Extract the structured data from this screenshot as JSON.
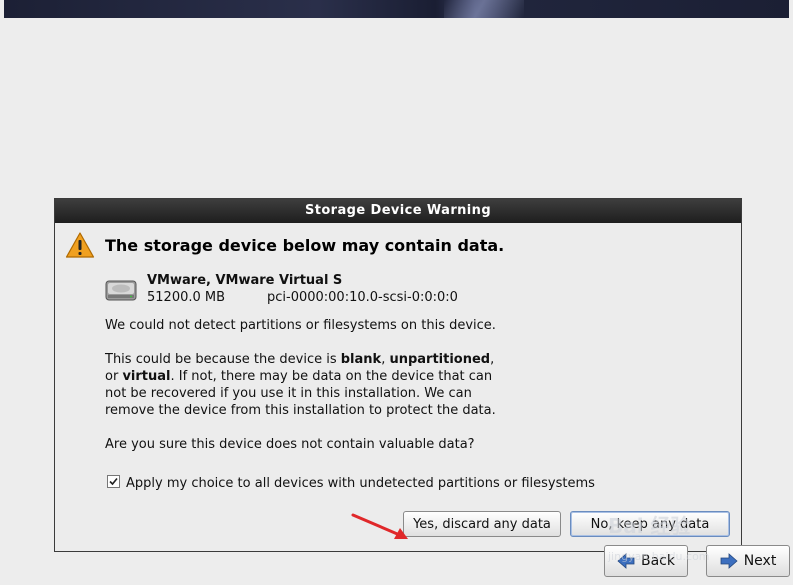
{
  "dialog": {
    "title": "Storage Device Warning",
    "headline": "The storage device below may contain data.",
    "device": {
      "name": "VMware, VMware Virtual S",
      "size": "51200.0 MB",
      "path": "pci-0000:00:10.0-scsi-0:0:0:0"
    },
    "para1": "We could not detect partitions or filesystems on this device.",
    "para2": {
      "l1a": "This could be because the device is ",
      "l1b": "blank",
      "l1c": ", ",
      "l1d": "unpartitioned",
      "l1e": ",",
      "l2a": "or ",
      "l2b": "virtual",
      "l2c": ". If not, there may be data on the device that can",
      "l3": "not be recovered if you use it in this installation. We can",
      "l4": "remove the device from this installation to protect the data."
    },
    "question": "Are you sure this device does not contain valuable data?",
    "checkbox": {
      "label": "Apply my choice to all devices with undetected partitions or filesystems",
      "checked": true
    },
    "buttons": {
      "yes": "Yes, discard any data",
      "no": "No, keep any data"
    }
  },
  "nav": {
    "back": "Back",
    "next": "Next"
  },
  "watermark": {
    "text": "Bai 经验",
    "url": "jingyan.baidu.com"
  },
  "colors": {
    "titlebar": "#2a2a2a",
    "warning": "#f0a020",
    "annotation_arrow": "#e0282a"
  },
  "icons": {
    "warning": "warning-triangle-icon",
    "disk": "hard-disk-icon",
    "back": "back-arrow-icon",
    "next": "next-arrow-icon"
  }
}
